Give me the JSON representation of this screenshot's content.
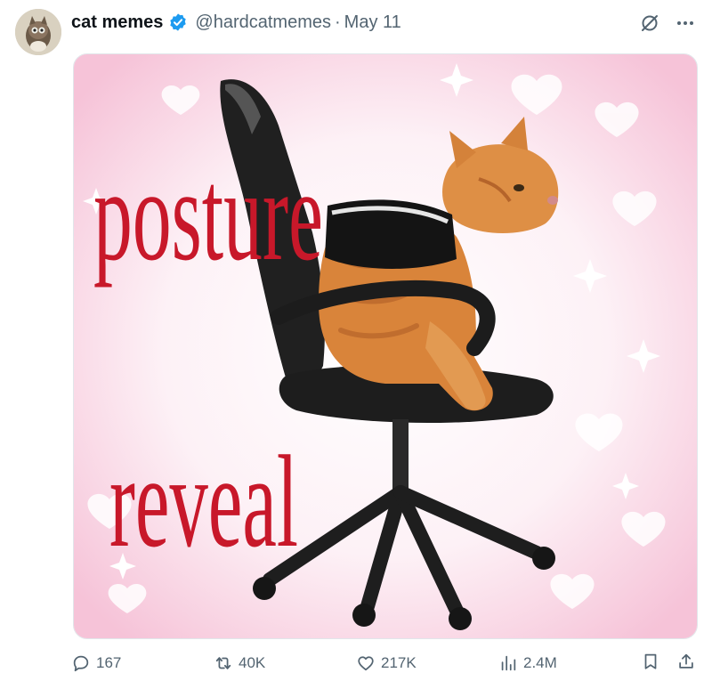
{
  "post": {
    "author_name": "cat memes",
    "handle": "@hardcatmemes",
    "separator": "·",
    "date": "May 11",
    "verified": true
  },
  "media": {
    "caption_line_1": "posture",
    "caption_line_2": "reveal",
    "caption_color": "#c8182a"
  },
  "metrics": {
    "replies": "167",
    "reposts": "40K",
    "likes": "217K",
    "views": "2.4M"
  },
  "icons": {
    "top": [
      "grok-icon",
      "more-icon"
    ],
    "actions": [
      "reply-icon",
      "repost-icon",
      "like-icon",
      "views-icon",
      "bookmark-icon",
      "share-icon"
    ]
  },
  "colors": {
    "verified_blue": "#1d9bf0",
    "muted_text": "#536471",
    "name_text": "#0f1419"
  }
}
